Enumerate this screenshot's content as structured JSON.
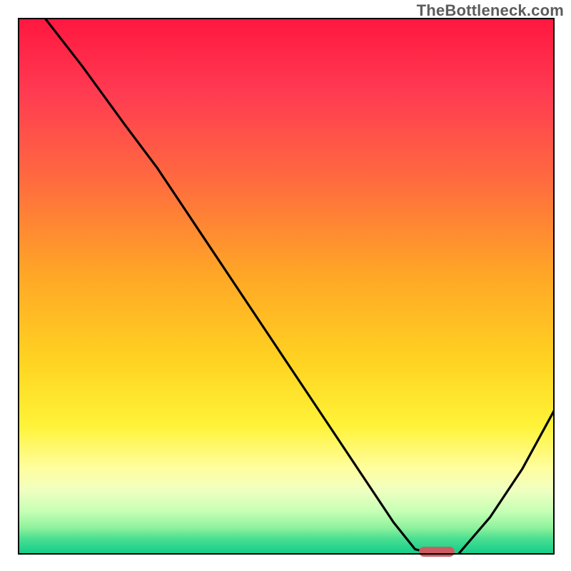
{
  "watermark": "TheBottleneck.com",
  "colors": {
    "curve_stroke": "#000000",
    "marker_fill": "#cb5d62",
    "frame": "#000000"
  },
  "chart_data": {
    "type": "line",
    "title": "",
    "xlabel": "",
    "ylabel": "",
    "xlim": [
      0,
      100
    ],
    "ylim": [
      0,
      100
    ],
    "grid": false,
    "background": "rainbow-vertical-gradient",
    "series": [
      {
        "name": "bottleneck-curve",
        "x": [
          5,
          12,
          20,
          26,
          34,
          42,
          50,
          58,
          64,
          70,
          74,
          78,
          82,
          88,
          94,
          100
        ],
        "y": [
          100,
          91,
          80,
          72,
          60,
          48,
          36,
          24,
          15,
          6,
          1,
          0,
          0,
          7,
          16,
          27
        ]
      }
    ],
    "annotations": [
      {
        "name": "optimal-marker",
        "x": 78,
        "y": 0.5,
        "shape": "rounded-bar"
      }
    ],
    "gradient_stops": [
      {
        "pos": 0,
        "color": "#ff173f"
      },
      {
        "pos": 14,
        "color": "#ff3b52"
      },
      {
        "pos": 30,
        "color": "#ff6a3f"
      },
      {
        "pos": 48,
        "color": "#ffa726"
      },
      {
        "pos": 64,
        "color": "#ffd321"
      },
      {
        "pos": 76,
        "color": "#fff338"
      },
      {
        "pos": 84,
        "color": "#fffea0"
      },
      {
        "pos": 88,
        "color": "#f0ffc0"
      },
      {
        "pos": 92,
        "color": "#c5ffb5"
      },
      {
        "pos": 95,
        "color": "#8ef29d"
      },
      {
        "pos": 97,
        "color": "#4cdf91"
      },
      {
        "pos": 99,
        "color": "#22d28c"
      },
      {
        "pos": 100,
        "color": "#15cc88"
      }
    ]
  }
}
